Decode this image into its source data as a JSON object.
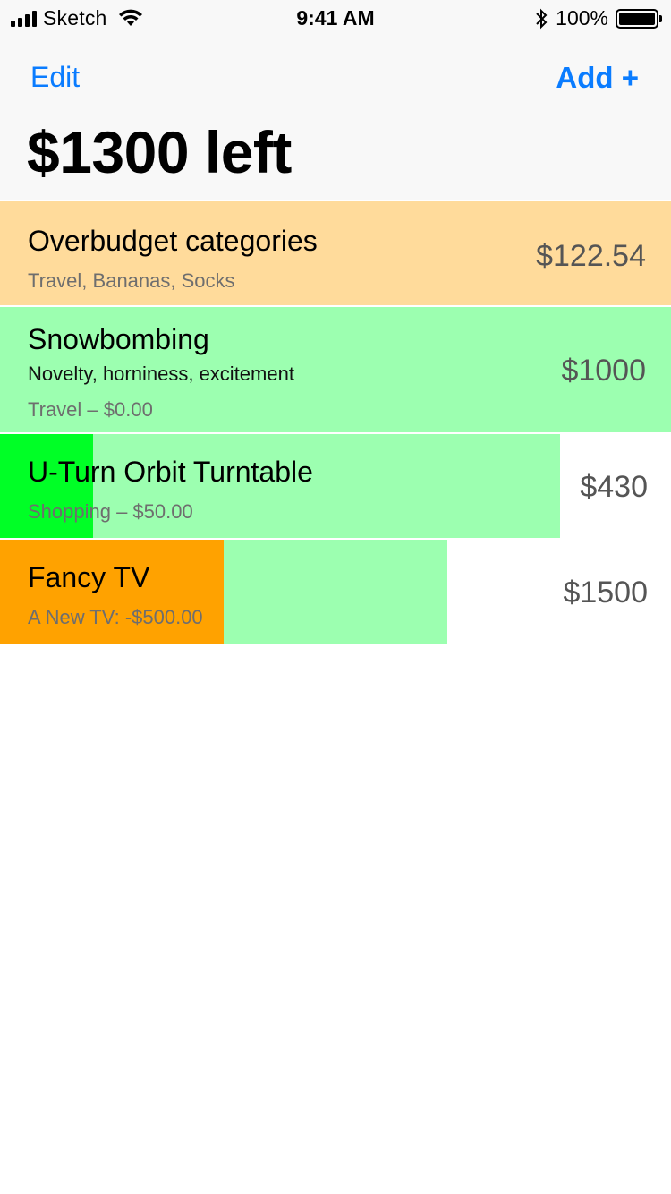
{
  "status_bar": {
    "carrier": "Sketch",
    "time": "9:41 AM",
    "battery_percent": "100%",
    "battery_level": 1.0,
    "icons": [
      "signal-icon",
      "wifi-icon",
      "bluetooth-icon",
      "battery-icon"
    ]
  },
  "nav": {
    "edit_label": "Edit",
    "add_label": "Add +",
    "title": "$1300 left"
  },
  "colors": {
    "accent": "#0a7cff",
    "overbudget_bg": "#ffdb9b",
    "progress_bg": "#9cffb0",
    "progress_spent_green": "#00ff26",
    "progress_spent_orange": "#ffa200",
    "nav_bg": "#f8f8f8"
  },
  "rows": [
    {
      "title": "Overbudget categories",
      "subtitle": "Travel, Bananas, Socks",
      "amount": "$122.54"
    },
    {
      "title": "Snowbombing",
      "description": "Novelty, horniness, excitement",
      "subtitle": "Travel – $0.00",
      "amount": "$1000",
      "progress": 1.0
    },
    {
      "title": "U-Turn Orbit Turntable",
      "subtitle": "Shopping – $50.00",
      "amount": "$430",
      "progress": 0.835,
      "spent_fraction": 0.139
    },
    {
      "title": "Fancy TV",
      "subtitle": "A New TV: -$500.00",
      "amount": "$1500",
      "progress": 0.667,
      "spent_fraction": 0.333
    }
  ]
}
